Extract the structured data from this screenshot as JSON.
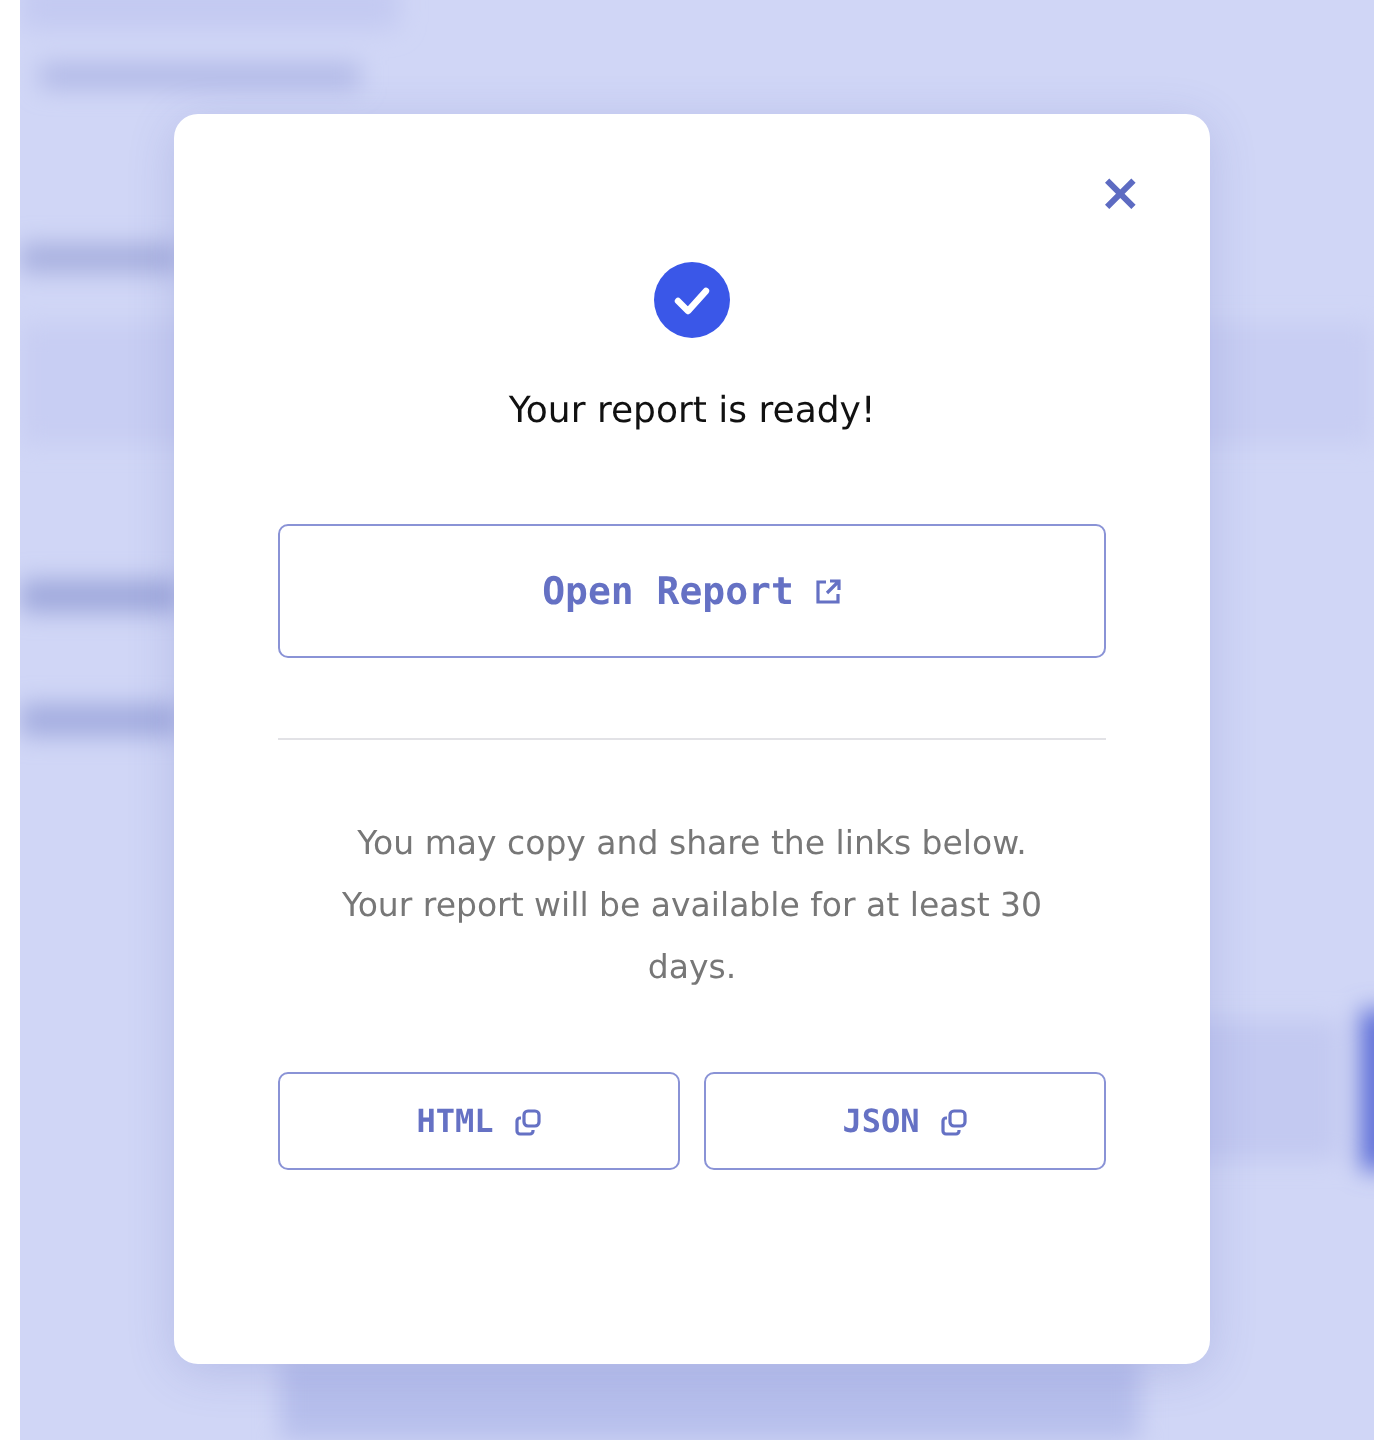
{
  "dialog": {
    "kind": "success",
    "title": "Your report is ready!",
    "close_label": "×",
    "open_button": {
      "label": "Open Report"
    },
    "message": "You may copy and share the links below. Your report will be available for at least 30 days.",
    "copy_buttons": [
      {
        "label": "HTML"
      },
      {
        "label": "JSON"
      }
    ]
  }
}
